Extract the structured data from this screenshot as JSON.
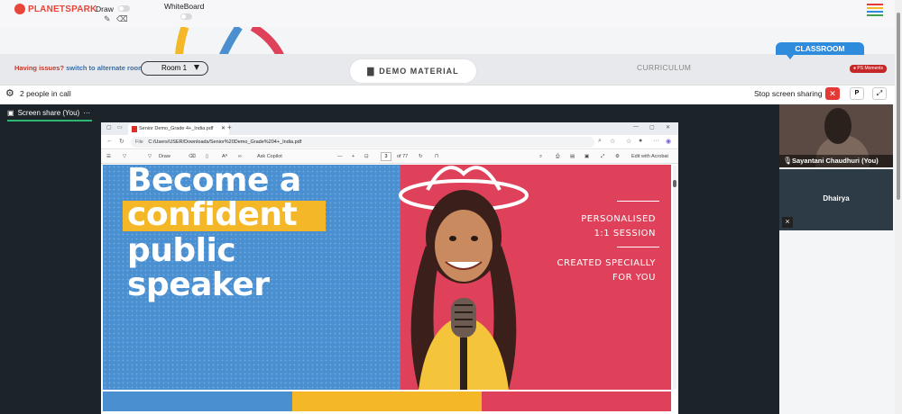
{
  "app": {
    "logo_text": "PLANETSPARK",
    "draw_label": "Draw",
    "whiteboard_label": "WhiteBoard",
    "hamburger_colors": [
      "#e53935",
      "#f4b728",
      "#2f8bdc",
      "#43a047"
    ]
  },
  "classroom": {
    "help_prefix": "Having issues?",
    "help_link": "switch to alternate room",
    "room_value": "Room 1",
    "demo_material_label": "DEMO MATERIAL",
    "curriculum_label": "CURRICULUM",
    "classroom_tab_label": "CLASSROOM",
    "ps_moments_label": "PS Moments"
  },
  "call": {
    "people_count_label": "2 people in call",
    "stop_share_label": "Stop screen sharing",
    "p_button_label": "P",
    "share_tab_label": "Screen share (You)"
  },
  "participants": [
    {
      "name": "Sayantani Chaudhuri (You)",
      "mic": "on"
    },
    {
      "name": "Dhairya",
      "mic": "off"
    }
  ],
  "browser": {
    "tab_title": "Senior Demo_Grade 4+_India.pdf",
    "url_scheme": "File",
    "url": "C:/Users/USER/Downloads/Senior%20Demo_Grade%204+_India.pdf",
    "pdf_toolbar": {
      "draw_label": "Draw",
      "ask_copilot_label": "Ask Copilot",
      "page_number": "3",
      "page_total": "of 77",
      "edit_acrobat_label": "Edit with Acrobat"
    }
  },
  "pdf_page": {
    "headline": [
      "Become a",
      "confident",
      "public",
      "speaker"
    ],
    "side_block_1": [
      "PERSONALISED",
      "1:1 SESSION"
    ],
    "side_block_2": [
      "CREATED SPECIALLY",
      "FOR YOU"
    ],
    "colors": {
      "blue": "#4a8fd0",
      "yellow": "#f4b728",
      "pink": "#e0415a"
    }
  }
}
